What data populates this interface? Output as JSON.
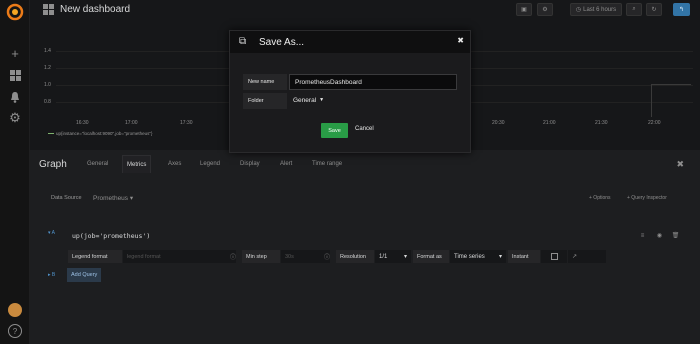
{
  "topbar": {
    "dashboard_title": "New dashboard",
    "time_range": "Last 6 hours",
    "icons": [
      "dashboard-grid-icon",
      "save-icon",
      "settings-icon",
      "clock-icon",
      "refresh-icon",
      "back-icon"
    ]
  },
  "sidebar": {
    "icons": [
      "grafana-logo",
      "plus-icon",
      "dashboards-icon",
      "bell-icon",
      "gear-icon",
      "user-avatar",
      "help-icon"
    ]
  },
  "graph": {
    "y_ticks": [
      "1.4",
      "1.2",
      "1.0",
      "0.8"
    ],
    "x_ticks": [
      "16:30",
      "17:00",
      "17:30",
      "20:30",
      "21:00",
      "21:30",
      "22:00"
    ],
    "legend": "up{instance=\"localhost:9090\",job=\"prometheus\"}"
  },
  "editor": {
    "title": "Graph",
    "tabs": [
      "General",
      "Metrics",
      "Axes",
      "Legend",
      "Display",
      "Alert",
      "Time range"
    ],
    "active_tab": "Metrics",
    "data_source_label": "Data Source",
    "data_source_value": "Prometheus",
    "options_label": "+ Options",
    "query_inspector_label": "+ Query Inspector",
    "query": {
      "letter": "A",
      "expression": "up(job='prometheus')",
      "legend_format_label": "Legend format",
      "legend_format_placeholder": "legend format",
      "min_step_label": "Min step",
      "min_step_placeholder": "30s",
      "resolution_label": "Resolution",
      "resolution_value": "1/1",
      "format_as_label": "Format as",
      "format_as_value": "Time series",
      "instant_label": "Instant"
    },
    "add_query_letter": "B",
    "add_query_label": "Add Query"
  },
  "modal": {
    "title": "Save As...",
    "new_name_label": "New name",
    "new_name_value": "PrometheusDashboard",
    "folder_label": "Folder",
    "folder_value": "General",
    "save_label": "Save",
    "cancel_label": "Cancel"
  }
}
